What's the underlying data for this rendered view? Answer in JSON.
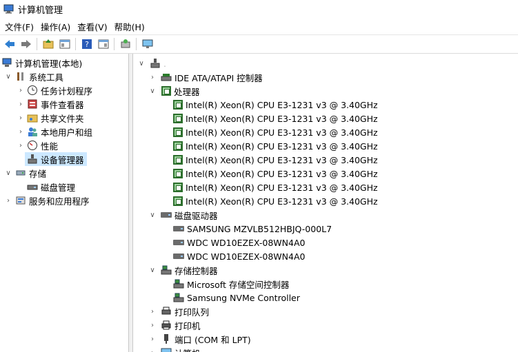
{
  "window": {
    "title": "计算机管理"
  },
  "menu": [
    "文件(F)",
    "操作(A)",
    "查看(V)",
    "帮助(H)"
  ],
  "toolbar": [
    "back-icon",
    "forward-icon",
    "up-folder-icon",
    "show-tree-icon",
    "help-icon",
    "properties-icon",
    "export-icon",
    "monitor-icon"
  ],
  "left_tree": {
    "root": "计算机管理(本地)",
    "items": [
      {
        "label": "系统工具",
        "level": 1,
        "expanded": true,
        "icon": "tools-icon"
      },
      {
        "label": "任务计划程序",
        "level": 2,
        "expanded": false,
        "icon": "clock-icon"
      },
      {
        "label": "事件查看器",
        "level": 2,
        "expanded": false,
        "icon": "event-viewer-icon"
      },
      {
        "label": "共享文件夹",
        "level": 2,
        "expanded": false,
        "icon": "shared-folder-icon"
      },
      {
        "label": "本地用户和组",
        "level": 2,
        "expanded": false,
        "icon": "users-icon"
      },
      {
        "label": "性能",
        "level": 2,
        "expanded": false,
        "icon": "performance-icon"
      },
      {
        "label": "设备管理器",
        "level": 2,
        "selected": true,
        "icon": "device-manager-icon"
      },
      {
        "label": "存储",
        "level": 1,
        "expanded": true,
        "icon": "storage-icon"
      },
      {
        "label": "磁盘管理",
        "level": 2,
        "icon": "disk-management-icon"
      },
      {
        "label": "服务和应用程序",
        "level": 1,
        "expanded": false,
        "icon": "services-icon"
      }
    ]
  },
  "device_tree": {
    "computer_name": ".",
    "categories": [
      {
        "label": "IDE ATA/ATAPI 控制器",
        "expanded": false,
        "icon": "ide-controller-icon",
        "children": []
      },
      {
        "label": "处理器",
        "expanded": true,
        "icon": "processor-icon",
        "children": [
          "Intel(R) Xeon(R) CPU E3-1231 v3 @ 3.40GHz",
          "Intel(R) Xeon(R) CPU E3-1231 v3 @ 3.40GHz",
          "Intel(R) Xeon(R) CPU E3-1231 v3 @ 3.40GHz",
          "Intel(R) Xeon(R) CPU E3-1231 v3 @ 3.40GHz",
          "Intel(R) Xeon(R) CPU E3-1231 v3 @ 3.40GHz",
          "Intel(R) Xeon(R) CPU E3-1231 v3 @ 3.40GHz",
          "Intel(R) Xeon(R) CPU E3-1231 v3 @ 3.40GHz",
          "Intel(R) Xeon(R) CPU E3-1231 v3 @ 3.40GHz"
        ]
      },
      {
        "label": "磁盘驱动器",
        "expanded": true,
        "icon": "disk-drive-icon",
        "children": [
          "SAMSUNG MZVLB512HBJQ-000L7",
          "WDC WD10EZEX-08WN4A0",
          "WDC WD10EZEX-08WN4A0"
        ]
      },
      {
        "label": "存储控制器",
        "expanded": true,
        "icon": "storage-controller-icon",
        "children": [
          "Microsoft 存储空间控制器",
          "Samsung NVMe Controller"
        ]
      },
      {
        "label": "打印队列",
        "expanded": false,
        "icon": "print-queue-icon",
        "children": []
      },
      {
        "label": "打印机",
        "expanded": false,
        "icon": "printer-icon",
        "children": []
      },
      {
        "label": "端口 (COM 和 LPT)",
        "expanded": false,
        "icon": "port-icon",
        "children": []
      },
      {
        "label": "计算机",
        "expanded": false,
        "icon": "computer-icon",
        "children": []
      }
    ]
  }
}
